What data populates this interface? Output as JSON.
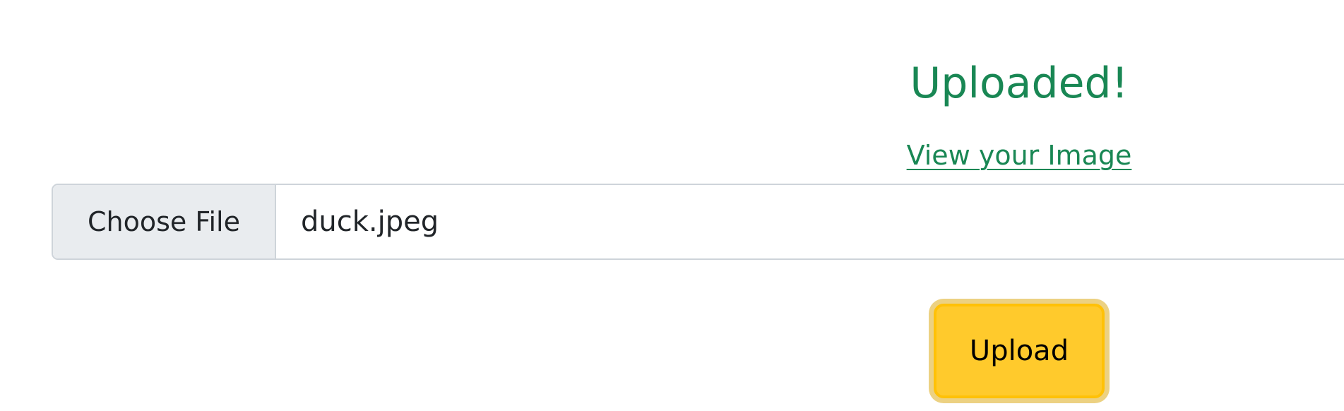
{
  "status": {
    "title": "Uploaded!",
    "link_text": "View your Image"
  },
  "file_input": {
    "button_label": "Choose File",
    "file_name": "duck.jpeg"
  },
  "upload": {
    "label": "Upload"
  },
  "colors": {
    "success": "#198754",
    "warning": "#ffc107",
    "warning_hover": "#ffca2c",
    "input_border": "#ced4da",
    "file_button_bg": "#e9ecef"
  }
}
